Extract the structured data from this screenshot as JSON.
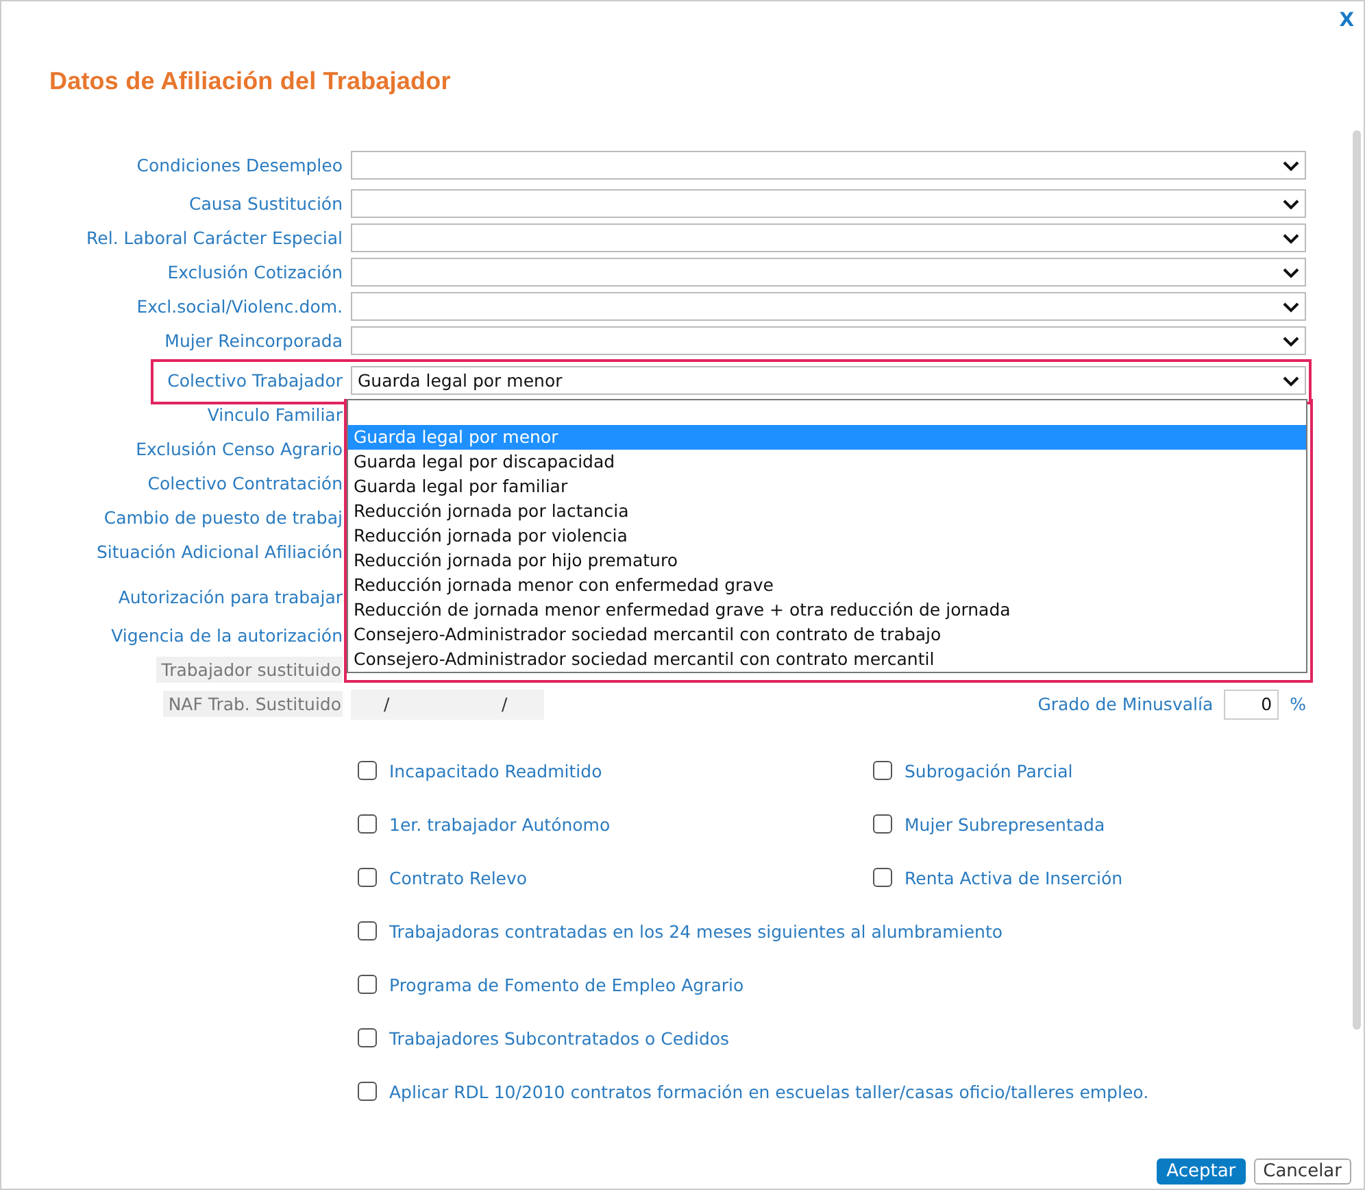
{
  "dialog": {
    "title": "Datos de Afiliación del Trabajador",
    "close": "X"
  },
  "fields": [
    {
      "label": "Condiciones Desempleo",
      "kind": "select"
    },
    {
      "label": "Causa Sustitución",
      "kind": "select"
    },
    {
      "label": "Rel. Laboral Carácter Especial",
      "kind": "select"
    },
    {
      "label": "Exclusión Cotización",
      "kind": "select"
    },
    {
      "label": "Excl.social/Violenc.dom.",
      "kind": "select"
    },
    {
      "label": "Mujer Reincorporada",
      "kind": "select"
    },
    {
      "label": "Colectivo Trabajador",
      "kind": "select",
      "value": "Guarda legal por menor",
      "open": true,
      "highlighted": true
    },
    {
      "label": "Vinculo Familiar",
      "kind": "covered"
    },
    {
      "label": "Exclusión Censo Agrario",
      "kind": "covered"
    },
    {
      "label": "Colectivo Contratación",
      "kind": "covered"
    },
    {
      "label": "Cambio de puesto de trabaj",
      "kind": "covered"
    },
    {
      "label": "Situación Adicional Afiliación",
      "kind": "covered"
    },
    {
      "label": "Autorización para trabajar",
      "kind": "covered"
    },
    {
      "label": "Vigencia de la autorización",
      "kind": "covered"
    },
    {
      "label": "Trabajador sustituido",
      "kind": "disabled"
    },
    {
      "label": "NAF Trab. Sustituido",
      "kind": "naf",
      "separators": [
        "/",
        "/"
      ]
    }
  ],
  "dropdown": {
    "highlighted": true,
    "options": [
      {
        "label": "Guarda legal por menor",
        "selected": true
      },
      {
        "label": "Guarda legal por discapacidad",
        "selected": false
      },
      {
        "label": "Guarda legal por familiar",
        "selected": false
      },
      {
        "label": "Reducción jornada por lactancia",
        "selected": false
      },
      {
        "label": "Reducción jornada por violencia",
        "selected": false
      },
      {
        "label": "Reducción jornada por hijo prematuro",
        "selected": false
      },
      {
        "label": "Reducción jornada menor con enfermedad grave",
        "selected": false
      },
      {
        "label": "Reducción de jornada menor enfermedad grave + otra reducción de jornada",
        "selected": false
      },
      {
        "label": "Consejero-Administrador sociedad mercantil con contrato de trabajo",
        "selected": false
      },
      {
        "label": "Consejero-Administrador sociedad mercantil con contrato mercantil",
        "selected": false
      }
    ]
  },
  "disability": {
    "label": "Grado de Minusvalía",
    "value": "0",
    "unit": "%"
  },
  "checkboxes": [
    {
      "label": "Incapacitado Readmitido",
      "checked": false,
      "kind": "half"
    },
    {
      "label": "Subrogación Parcial",
      "checked": false,
      "kind": "half"
    },
    {
      "label": "1er. trabajador Autónomo",
      "checked": false,
      "kind": "half"
    },
    {
      "label": "Mujer Subrepresentada",
      "checked": false,
      "kind": "half"
    },
    {
      "label": "Contrato Relevo",
      "checked": false,
      "kind": "half"
    },
    {
      "label": "Renta Activa de Inserción",
      "checked": false,
      "kind": "half"
    },
    {
      "label": "Trabajadoras contratadas en los 24 meses siguientes al alumbramiento",
      "checked": false,
      "kind": "full"
    },
    {
      "label": "Programa de Fomento de Empleo Agrario",
      "checked": false,
      "kind": "full"
    },
    {
      "label": "Trabajadores Subcontratados o Cedidos",
      "checked": false,
      "kind": "full"
    },
    {
      "label": "Aplicar RDL 10/2010 contratos formación en escuelas taller/casas oficio/talleres empleo.",
      "checked": false,
      "kind": "full"
    }
  ],
  "buttons": [
    {
      "label": "Aceptar",
      "kind": "primary"
    },
    {
      "label": "Cancelar",
      "kind": "secondary"
    }
  ]
}
